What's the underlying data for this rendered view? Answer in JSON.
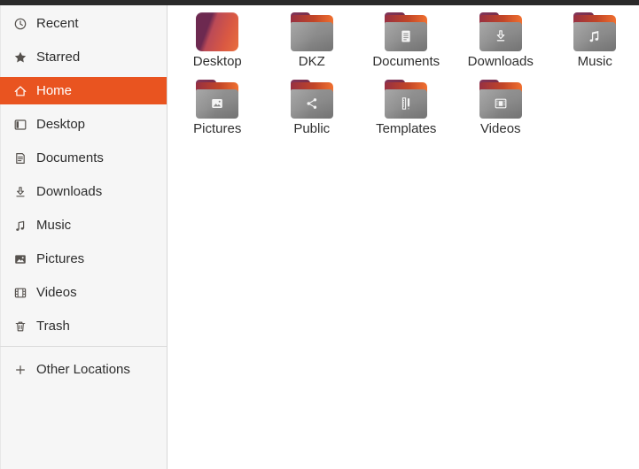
{
  "colors": {
    "accent_orange": "#E95420",
    "topbar": "#2a2a2a",
    "sidebar_bg": "#f6f6f6",
    "main_bg": "#ffffff",
    "folder_gray": "#8a8a8a",
    "folder_tab_maroon": "#7c3150",
    "folder_back_orange": "#f07030",
    "text": "#2d2d2d",
    "selected_text": "#ffffff"
  },
  "sidebar": {
    "items": [
      {
        "label": "Recent",
        "icon": "recent-clock-icon",
        "selected": false
      },
      {
        "label": "Starred",
        "icon": "star-icon",
        "selected": false
      },
      {
        "label": "Home",
        "icon": "home-icon",
        "selected": true
      },
      {
        "label": "Desktop",
        "icon": "desktop-icon",
        "selected": false
      },
      {
        "label": "Documents",
        "icon": "documents-icon",
        "selected": false
      },
      {
        "label": "Downloads",
        "icon": "downloads-icon",
        "selected": false
      },
      {
        "label": "Music",
        "icon": "music-icon",
        "selected": false
      },
      {
        "label": "Pictures",
        "icon": "pictures-icon",
        "selected": false
      },
      {
        "label": "Videos",
        "icon": "videos-icon",
        "selected": false
      },
      {
        "label": "Trash",
        "icon": "trash-icon",
        "selected": false
      }
    ],
    "footer_item": {
      "label": "Other Locations",
      "icon": "plus-icon"
    }
  },
  "files": {
    "items": [
      {
        "name": "Desktop",
        "kind": "desktop-special"
      },
      {
        "name": "DKZ",
        "kind": "folder",
        "emblem": "none"
      },
      {
        "name": "Documents",
        "kind": "folder",
        "emblem": "document"
      },
      {
        "name": "Downloads",
        "kind": "folder",
        "emblem": "download-arrow"
      },
      {
        "name": "Music",
        "kind": "folder",
        "emblem": "music-note"
      },
      {
        "name": "Pictures",
        "kind": "folder",
        "emblem": "photo"
      },
      {
        "name": "Public",
        "kind": "folder",
        "emblem": "share-nodes"
      },
      {
        "name": "Templates",
        "kind": "folder",
        "emblem": "ruler-pen"
      },
      {
        "name": "Videos",
        "kind": "folder",
        "emblem": "film-frame"
      }
    ]
  }
}
